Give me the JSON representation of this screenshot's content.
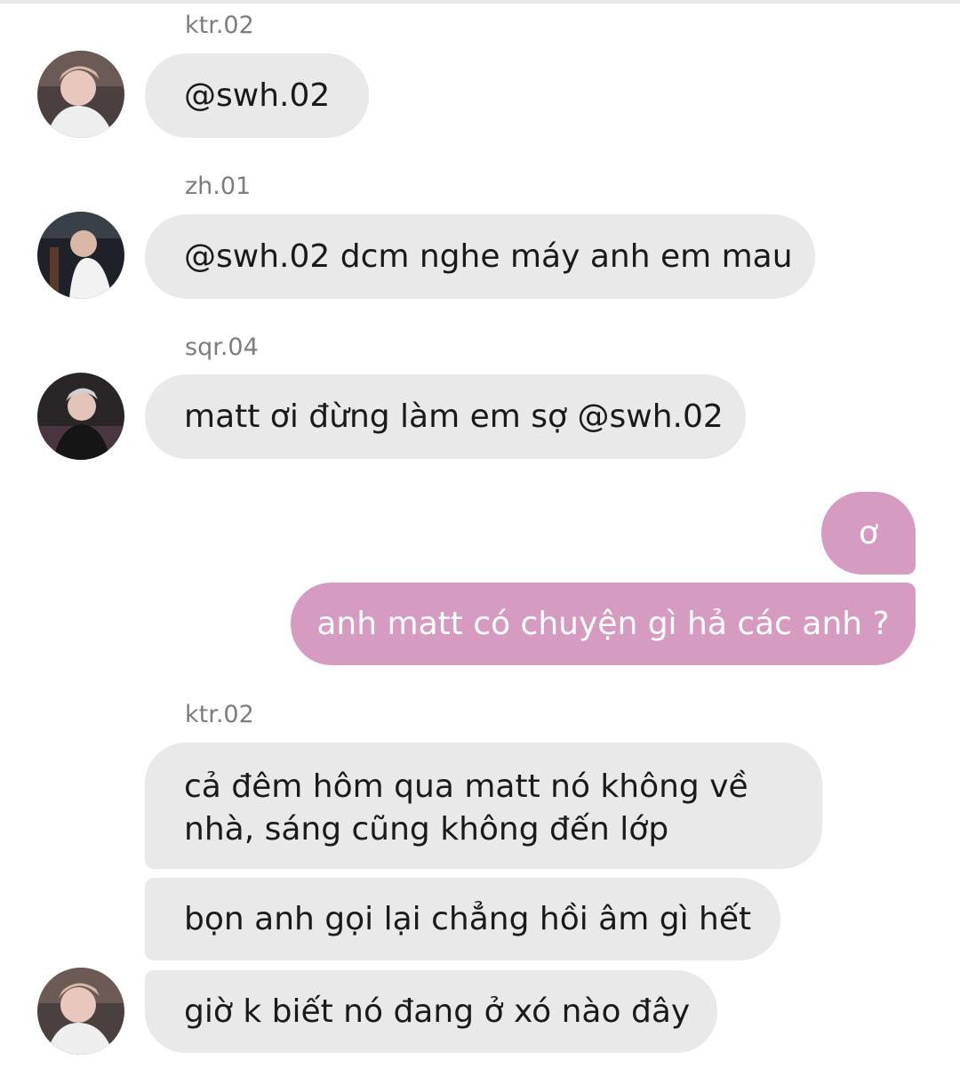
{
  "messages": [
    {
      "sender": "ktr.02",
      "text": "@swh.02"
    },
    {
      "sender": "zh.01",
      "text": "@swh.02 dcm nghe máy anh em mau"
    },
    {
      "sender": "sqr.04",
      "text": "matt ơi đừng làm em sợ @swh.02"
    },
    {
      "text": "ơ"
    },
    {
      "text": "anh matt có chuyện gì hả các anh ?"
    },
    {
      "sender": "ktr.02",
      "line1": "cả đêm hôm qua matt nó không về",
      "line2": "nhà, sáng cũng không đến lớp"
    },
    {
      "text": "bọn anh gọi lại chẳng hồi âm gì hết"
    },
    {
      "text": "giờ k biết nó đang ở xó nào đây"
    }
  ],
  "colors": {
    "incoming_bubble": "#e9e9e9",
    "outgoing_bubble": "#d69bc1",
    "sender_label": "#7d7d7d"
  }
}
